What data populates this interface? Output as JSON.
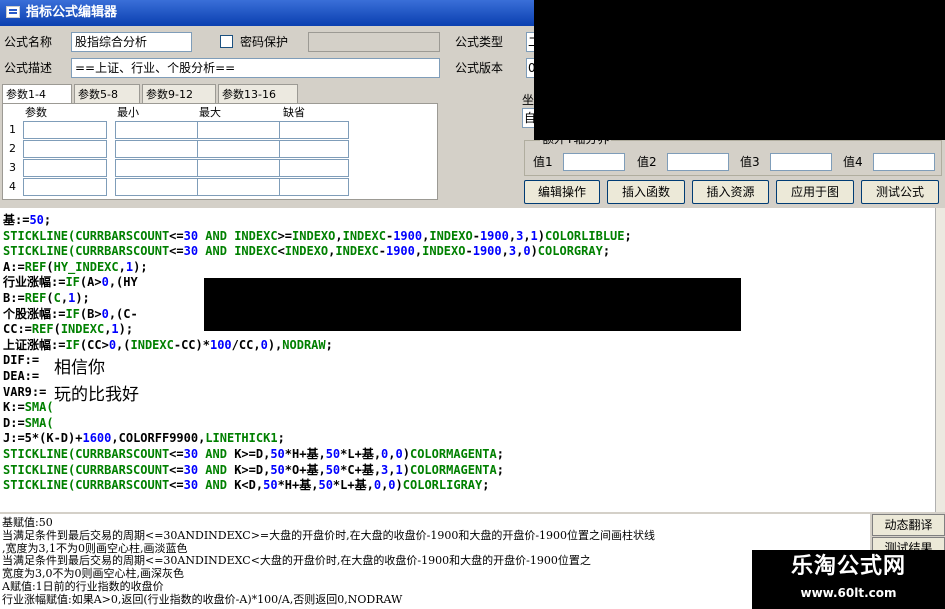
{
  "window": {
    "title": "指标公式编辑器"
  },
  "form": {
    "name_label": "公式名称",
    "name_value": "股指综合分析",
    "password_label": "密码保护",
    "desc_label": "公式描述",
    "desc_value": "==上证、行业、个股分析==",
    "type_label": "公式类型",
    "version_label": "公式版本",
    "type_value_partial": "二",
    "version_value_partial": "0"
  },
  "params": {
    "tabs": [
      "参数1-4",
      "参数5-8",
      "参数9-12",
      "参数13-16"
    ],
    "headers": [
      "参数",
      "最小",
      "最大",
      "缺省"
    ],
    "rows": [
      "1",
      "2",
      "3",
      "4"
    ]
  },
  "right_panel": {
    "partial_label": "坐",
    "partial_field": "自",
    "group_label": "额外Y轴分界",
    "values": [
      "值1",
      "值2",
      "值3",
      "值4"
    ]
  },
  "buttons": [
    "编辑操作",
    "插入函数",
    "插入资源",
    "应用于图",
    "测试公式"
  ],
  "code_lines": [
    [
      [
        "k",
        "基:="
      ],
      [
        "n",
        "50"
      ],
      [
        "k",
        ";"
      ]
    ],
    [
      [
        "g",
        "STICKLINE(CURRBARSCOUNT"
      ],
      [
        "k",
        "<="
      ],
      [
        "n",
        "30"
      ],
      [
        "g",
        " AND "
      ],
      [
        "g",
        "INDEXC"
      ],
      [
        "k",
        ">="
      ],
      [
        "g",
        "INDEXO"
      ],
      [
        "k",
        ","
      ],
      [
        "g",
        "INDEXC"
      ],
      [
        "k",
        "-"
      ],
      [
        "n",
        "1900"
      ],
      [
        "k",
        ","
      ],
      [
        "g",
        "INDEXO"
      ],
      [
        "k",
        "-"
      ],
      [
        "n",
        "1900"
      ],
      [
        "k",
        ","
      ],
      [
        "n",
        "3"
      ],
      [
        "k",
        ","
      ],
      [
        "n",
        "1"
      ],
      [
        "k",
        ")"
      ],
      [
        "g",
        "COLORLIBLUE"
      ],
      [
        "k",
        ";"
      ]
    ],
    [
      [
        "g",
        "STICKLINE(CURRBARSCOUNT"
      ],
      [
        "k",
        "<="
      ],
      [
        "n",
        "30"
      ],
      [
        "g",
        " AND "
      ],
      [
        "g",
        "INDEXC"
      ],
      [
        "k",
        "<"
      ],
      [
        "g",
        "INDEXO"
      ],
      [
        "k",
        ","
      ],
      [
        "g",
        "INDEXC"
      ],
      [
        "k",
        "-"
      ],
      [
        "n",
        "1900"
      ],
      [
        "k",
        ","
      ],
      [
        "g",
        "INDEXO"
      ],
      [
        "k",
        "-"
      ],
      [
        "n",
        "1900"
      ],
      [
        "k",
        ","
      ],
      [
        "n",
        "3"
      ],
      [
        "k",
        ","
      ],
      [
        "n",
        "0"
      ],
      [
        "k",
        ")"
      ],
      [
        "g",
        "COLORGRAY"
      ],
      [
        "k",
        ";"
      ]
    ],
    [
      [
        "k",
        "A:="
      ],
      [
        "g",
        "REF"
      ],
      [
        "k",
        "("
      ],
      [
        "g",
        "HY_INDEXC"
      ],
      [
        "k",
        ","
      ],
      [
        "n",
        "1"
      ],
      [
        "k",
        ");"
      ]
    ],
    [
      [
        "k",
        "行业涨幅:="
      ],
      [
        "g",
        "IF"
      ],
      [
        "k",
        "(A>"
      ],
      [
        "n",
        "0"
      ],
      [
        "k",
        ",(HY"
      ]
    ],
    [
      [
        "k",
        "B:="
      ],
      [
        "g",
        "REF"
      ],
      [
        "k",
        "("
      ],
      [
        "g",
        "C"
      ],
      [
        "k",
        ","
      ],
      [
        "n",
        "1"
      ],
      [
        "k",
        ");"
      ]
    ],
    [
      [
        "k",
        "个股涨幅:="
      ],
      [
        "g",
        "IF"
      ],
      [
        "k",
        "(B>"
      ],
      [
        "n",
        "0"
      ],
      [
        "k",
        ",(C-"
      ]
    ],
    [
      [
        "k",
        "CC:="
      ],
      [
        "g",
        "REF"
      ],
      [
        "k",
        "("
      ],
      [
        "g",
        "INDEXC"
      ],
      [
        "k",
        ","
      ],
      [
        "n",
        "1"
      ],
      [
        "k",
        ");"
      ]
    ],
    [
      [
        "k",
        "上证涨幅:="
      ],
      [
        "g",
        "IF"
      ],
      [
        "k",
        "(CC>"
      ],
      [
        "n",
        "0"
      ],
      [
        "k",
        ",("
      ],
      [
        "g",
        "INDEXC"
      ],
      [
        "k",
        "-CC)*"
      ],
      [
        "n",
        "100"
      ],
      [
        "k",
        "/CC,"
      ],
      [
        "n",
        "0"
      ],
      [
        "k",
        "),"
      ],
      [
        "g",
        "NODRAW"
      ],
      [
        "k",
        ";"
      ]
    ],
    [
      [
        "k",
        "DIF:="
      ]
    ],
    [
      [
        "k",
        "DEA:="
      ]
    ],
    [
      [
        "k",
        "VAR9:="
      ]
    ],
    [
      [
        "k",
        "K:="
      ],
      [
        "g",
        "SMA("
      ]
    ],
    [
      [
        "k",
        "D:="
      ],
      [
        "g",
        "SMA("
      ]
    ],
    [
      [
        "k",
        "J:=5*(K-D)+"
      ],
      [
        "n",
        "1600"
      ],
      [
        "k",
        ",COLORFF9900,"
      ],
      [
        "g",
        "LINETHICK1"
      ],
      [
        "k",
        ";"
      ]
    ],
    [
      [
        "g",
        "STICKLINE(CURRBARSCOUNT"
      ],
      [
        "k",
        "<="
      ],
      [
        "n",
        "30"
      ],
      [
        "g",
        " AND "
      ],
      [
        "k",
        "K>=D,"
      ],
      [
        "n",
        "50"
      ],
      [
        "k",
        "*H+基,"
      ],
      [
        "n",
        "50"
      ],
      [
        "k",
        "*L+基,"
      ],
      [
        "n",
        "0"
      ],
      [
        "k",
        ","
      ],
      [
        "n",
        "0"
      ],
      [
        "k",
        ")"
      ],
      [
        "g",
        "COLORMAGENTA"
      ],
      [
        "k",
        ";"
      ]
    ],
    [
      [
        "g",
        "STICKLINE(CURRBARSCOUNT"
      ],
      [
        "k",
        "<="
      ],
      [
        "n",
        "30"
      ],
      [
        "g",
        " AND "
      ],
      [
        "k",
        "K>=D,"
      ],
      [
        "n",
        "50"
      ],
      [
        "k",
        "*O+基,"
      ],
      [
        "n",
        "50"
      ],
      [
        "k",
        "*C+基,"
      ],
      [
        "n",
        "3"
      ],
      [
        "k",
        ","
      ],
      [
        "n",
        "1"
      ],
      [
        "k",
        ")"
      ],
      [
        "g",
        "COLORMAGENTA"
      ],
      [
        "k",
        ";"
      ]
    ],
    [
      [
        "g",
        "STICKLINE(CURRBARSCOUNT"
      ],
      [
        "k",
        "<="
      ],
      [
        "n",
        "30"
      ],
      [
        "g",
        " AND "
      ],
      [
        "k",
        "K<D,"
      ],
      [
        "n",
        "50"
      ],
      [
        "k",
        "*H+基,"
      ],
      [
        "n",
        "50"
      ],
      [
        "k",
        "*L+基,"
      ],
      [
        "n",
        "0"
      ],
      [
        "k",
        ","
      ],
      [
        "n",
        "0"
      ],
      [
        "k",
        ")"
      ],
      [
        "g",
        "COLORLIGRAY"
      ],
      [
        "k",
        ";"
      ]
    ]
  ],
  "overlay_text": [
    "相信你",
    "玩的比我好"
  ],
  "output_lines": [
    "基赋值:50",
    "当满足条件到最后交易的周期<=30ANDINDEXC>=大盘的开盘价时,在大盘的收盘价-1900和大盘的开盘价-1900位置之间画柱状线",
    ",宽度为3,1不为0则画空心柱,画淡蓝色",
    "当满足条件到最后交易的周期<=30ANDINDEXC<大盘的开盘价时,在大盘的收盘价-1900和大盘的开盘价-1900位置之",
    "宽度为3,0不为0则画空心柱,画深灰色",
    "A赋值:1日前的行业指数的收盘价",
    "行业涨幅赋值:如果A>0,返回(行业指数的收盘价-A)*100/A,否则返回0,NODRAW"
  ],
  "side_buttons": [
    "动态翻译",
    "测试结果"
  ],
  "watermark": {
    "name": "乐淘公式网",
    "url": "www.60lt.com"
  }
}
